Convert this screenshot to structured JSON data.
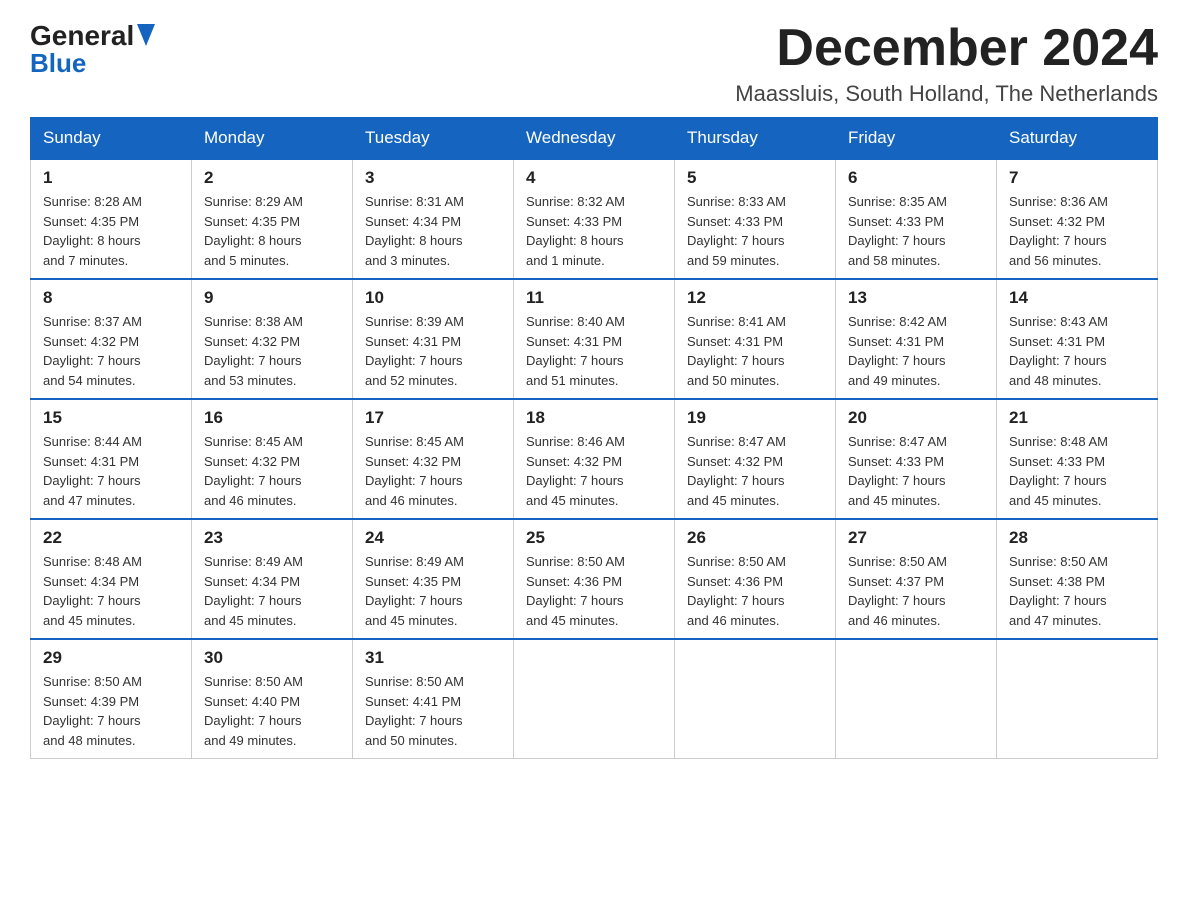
{
  "logo": {
    "text_general": "General",
    "text_blue": "Blue",
    "arrow": "▲"
  },
  "header": {
    "month_year": "December 2024",
    "location": "Maassluis, South Holland, The Netherlands"
  },
  "weekdays": [
    "Sunday",
    "Monday",
    "Tuesday",
    "Wednesday",
    "Thursday",
    "Friday",
    "Saturday"
  ],
  "weeks": [
    [
      {
        "day": "1",
        "sunrise": "8:28 AM",
        "sunset": "4:35 PM",
        "daylight": "8 hours and 7 minutes."
      },
      {
        "day": "2",
        "sunrise": "8:29 AM",
        "sunset": "4:35 PM",
        "daylight": "8 hours and 5 minutes."
      },
      {
        "day": "3",
        "sunrise": "8:31 AM",
        "sunset": "4:34 PM",
        "daylight": "8 hours and 3 minutes."
      },
      {
        "day": "4",
        "sunrise": "8:32 AM",
        "sunset": "4:33 PM",
        "daylight": "8 hours and 1 minute."
      },
      {
        "day": "5",
        "sunrise": "8:33 AM",
        "sunset": "4:33 PM",
        "daylight": "7 hours and 59 minutes."
      },
      {
        "day": "6",
        "sunrise": "8:35 AM",
        "sunset": "4:33 PM",
        "daylight": "7 hours and 58 minutes."
      },
      {
        "day": "7",
        "sunrise": "8:36 AM",
        "sunset": "4:32 PM",
        "daylight": "7 hours and 56 minutes."
      }
    ],
    [
      {
        "day": "8",
        "sunrise": "8:37 AM",
        "sunset": "4:32 PM",
        "daylight": "7 hours and 54 minutes."
      },
      {
        "day": "9",
        "sunrise": "8:38 AM",
        "sunset": "4:32 PM",
        "daylight": "7 hours and 53 minutes."
      },
      {
        "day": "10",
        "sunrise": "8:39 AM",
        "sunset": "4:31 PM",
        "daylight": "7 hours and 52 minutes."
      },
      {
        "day": "11",
        "sunrise": "8:40 AM",
        "sunset": "4:31 PM",
        "daylight": "7 hours and 51 minutes."
      },
      {
        "day": "12",
        "sunrise": "8:41 AM",
        "sunset": "4:31 PM",
        "daylight": "7 hours and 50 minutes."
      },
      {
        "day": "13",
        "sunrise": "8:42 AM",
        "sunset": "4:31 PM",
        "daylight": "7 hours and 49 minutes."
      },
      {
        "day": "14",
        "sunrise": "8:43 AM",
        "sunset": "4:31 PM",
        "daylight": "7 hours and 48 minutes."
      }
    ],
    [
      {
        "day": "15",
        "sunrise": "8:44 AM",
        "sunset": "4:31 PM",
        "daylight": "7 hours and 47 minutes."
      },
      {
        "day": "16",
        "sunrise": "8:45 AM",
        "sunset": "4:32 PM",
        "daylight": "7 hours and 46 minutes."
      },
      {
        "day": "17",
        "sunrise": "8:45 AM",
        "sunset": "4:32 PM",
        "daylight": "7 hours and 46 minutes."
      },
      {
        "day": "18",
        "sunrise": "8:46 AM",
        "sunset": "4:32 PM",
        "daylight": "7 hours and 45 minutes."
      },
      {
        "day": "19",
        "sunrise": "8:47 AM",
        "sunset": "4:32 PM",
        "daylight": "7 hours and 45 minutes."
      },
      {
        "day": "20",
        "sunrise": "8:47 AM",
        "sunset": "4:33 PM",
        "daylight": "7 hours and 45 minutes."
      },
      {
        "day": "21",
        "sunrise": "8:48 AM",
        "sunset": "4:33 PM",
        "daylight": "7 hours and 45 minutes."
      }
    ],
    [
      {
        "day": "22",
        "sunrise": "8:48 AM",
        "sunset": "4:34 PM",
        "daylight": "7 hours and 45 minutes."
      },
      {
        "day": "23",
        "sunrise": "8:49 AM",
        "sunset": "4:34 PM",
        "daylight": "7 hours and 45 minutes."
      },
      {
        "day": "24",
        "sunrise": "8:49 AM",
        "sunset": "4:35 PM",
        "daylight": "7 hours and 45 minutes."
      },
      {
        "day": "25",
        "sunrise": "8:50 AM",
        "sunset": "4:36 PM",
        "daylight": "7 hours and 45 minutes."
      },
      {
        "day": "26",
        "sunrise": "8:50 AM",
        "sunset": "4:36 PM",
        "daylight": "7 hours and 46 minutes."
      },
      {
        "day": "27",
        "sunrise": "8:50 AM",
        "sunset": "4:37 PM",
        "daylight": "7 hours and 46 minutes."
      },
      {
        "day": "28",
        "sunrise": "8:50 AM",
        "sunset": "4:38 PM",
        "daylight": "7 hours and 47 minutes."
      }
    ],
    [
      {
        "day": "29",
        "sunrise": "8:50 AM",
        "sunset": "4:39 PM",
        "daylight": "7 hours and 48 minutes."
      },
      {
        "day": "30",
        "sunrise": "8:50 AM",
        "sunset": "4:40 PM",
        "daylight": "7 hours and 49 minutes."
      },
      {
        "day": "31",
        "sunrise": "8:50 AM",
        "sunset": "4:41 PM",
        "daylight": "7 hours and 50 minutes."
      },
      null,
      null,
      null,
      null
    ]
  ],
  "labels": {
    "sunrise": "Sunrise:",
    "sunset": "Sunset:",
    "daylight": "Daylight:"
  }
}
